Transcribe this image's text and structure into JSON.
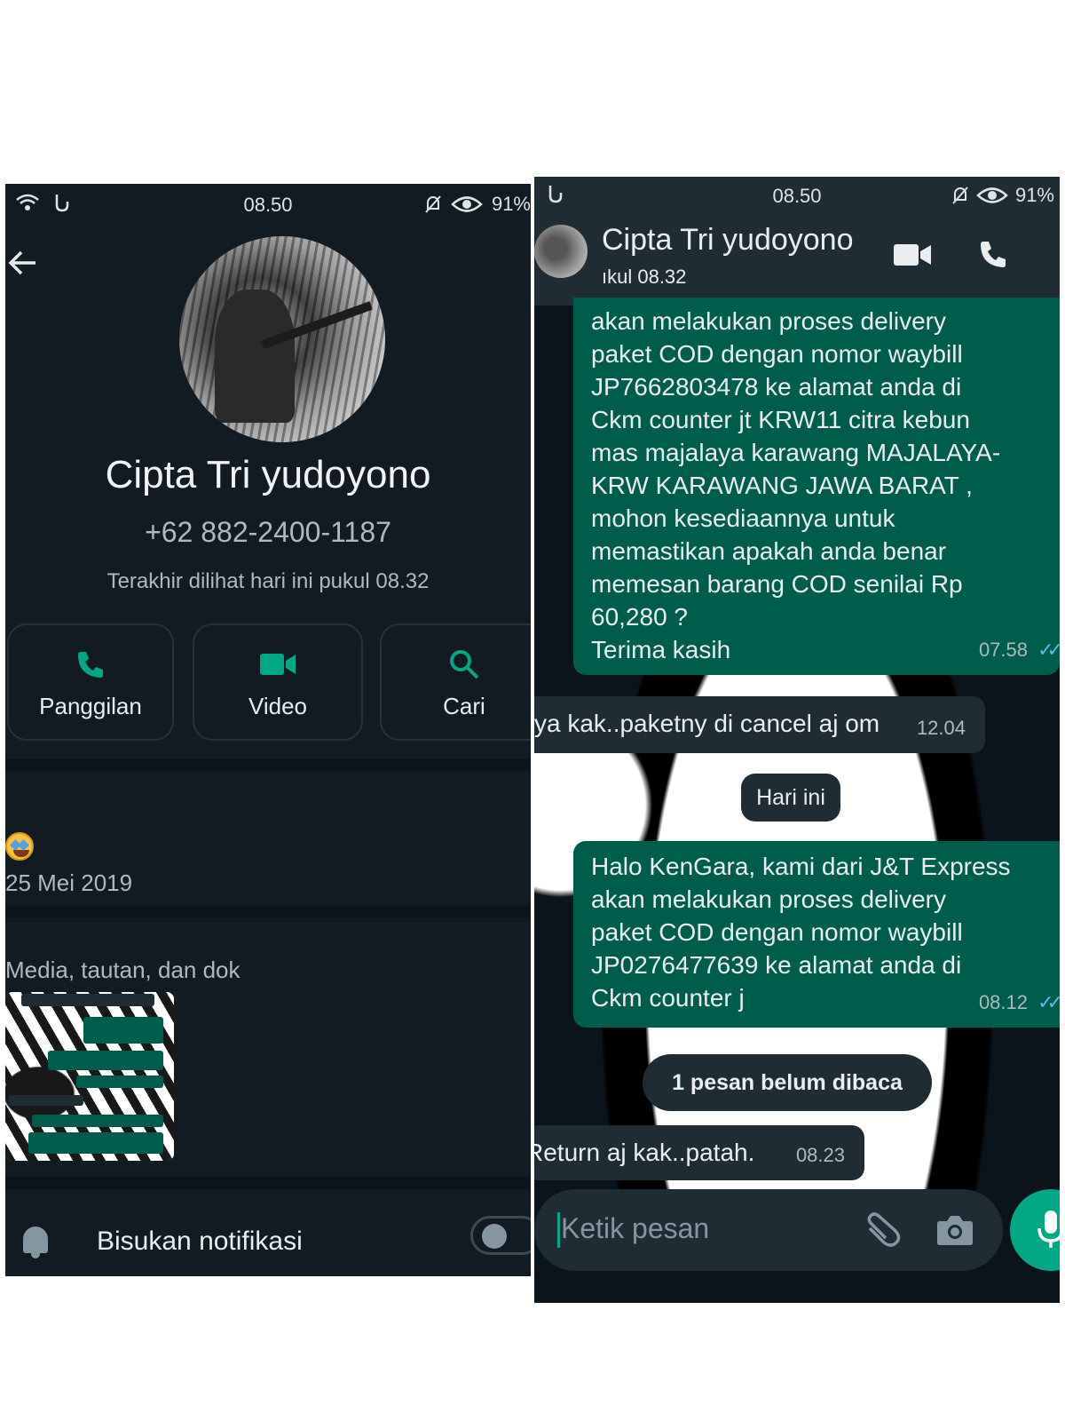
{
  "left": {
    "status_time": "08.50",
    "battery": "91%",
    "contact_name": "Cipta Tri yudoyono",
    "phone": "+62 882-2400-1187",
    "last_seen": "Terakhir dilihat hari ini pukul 08.32",
    "actions": [
      {
        "label": "Panggilan",
        "icon": "phone-icon"
      },
      {
        "label": "Video",
        "icon": "video-icon"
      },
      {
        "label": "Cari",
        "icon": "search-icon"
      }
    ],
    "about_emoji": "star-struck-emoji",
    "about_date": "25 Mei 2019",
    "media_title": "Media, tautan, dan dok",
    "notif_label": "Bisukan notifikasi",
    "notif_toggle_on": false
  },
  "right": {
    "status_time": "08.50",
    "battery": "91%",
    "chat_title": "Cipta Tri yudoyono",
    "chat_sub": "ıkul 08.32",
    "msg1_lines": [
      "akan melakukan proses delivery",
      "paket COD dengan nomor waybill",
      "JP7662803478 ke alamat anda di",
      "Ckm counter jt KRW11 citra kebun",
      "mas majalaya karawang MAJALAYA-",
      "KRW KARAWANG JAWA BARAT ,",
      "mohon kesediaannya untuk",
      "memastikan apakah anda benar",
      "memesan barang COD senilai Rp",
      "60,280 ?",
      "Terima kasih"
    ],
    "msg1_time": "07.58",
    "msg2_text": "ya kak..paketny di cancel aj om",
    "msg2_time": "12.04",
    "date_pill": "Hari ini",
    "msg3_lines": [
      "Halo KenGara, kami dari J&T Express",
      "akan melakukan proses delivery",
      "paket COD dengan nomor waybill",
      "JP0276477639 ke alamat anda di",
      "Ckm counter j"
    ],
    "msg3_time": "08.12",
    "unread_pill": "1 pesan belum dibaca",
    "msg4_text": "Return aj kak..patah.",
    "msg4_time": "08.23",
    "composer_placeholder": "Ketik pesan",
    "colors": {
      "outgoing": "#005c4b",
      "incoming": "#1f2c33",
      "accent": "#00a884",
      "read_ticks": "#53bdeb"
    }
  }
}
